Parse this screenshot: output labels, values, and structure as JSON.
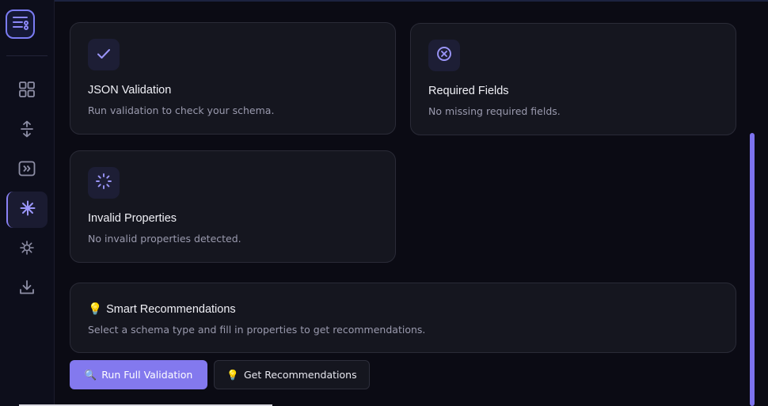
{
  "sidebar": {
    "logo_icon": "list-settings-icon",
    "items": [
      {
        "icon": "grid-icon",
        "active": false
      },
      {
        "icon": "resize-vertical-icon",
        "active": false
      },
      {
        "icon": "fast-forward-box-icon",
        "active": false
      },
      {
        "icon": "asterisk-icon",
        "active": true
      },
      {
        "icon": "virus-icon",
        "active": false
      },
      {
        "icon": "download-icon",
        "active": false
      }
    ]
  },
  "cards": {
    "json_validation": {
      "title": "JSON Validation",
      "text": "Run validation to check your schema.",
      "icon": "check-icon"
    },
    "required_fields": {
      "title": "Required Fields",
      "text": "No missing required fields.",
      "icon": "x-circle-icon"
    },
    "invalid_properties": {
      "title": "Invalid Properties",
      "text": "No invalid properties detected.",
      "icon": "loader-icon"
    }
  },
  "recommendations": {
    "emoji": "💡",
    "title": "Smart Recommendations",
    "text": "Select a schema type and fill in properties to get recommendations."
  },
  "buttons": {
    "run_emoji": "🔍",
    "run_label": "Run Full Validation",
    "rec_emoji": "💡",
    "rec_label": "Get Recommendations"
  },
  "colors": {
    "accent": "#8379ee",
    "background": "#0b0b14",
    "card": "#15161f"
  }
}
